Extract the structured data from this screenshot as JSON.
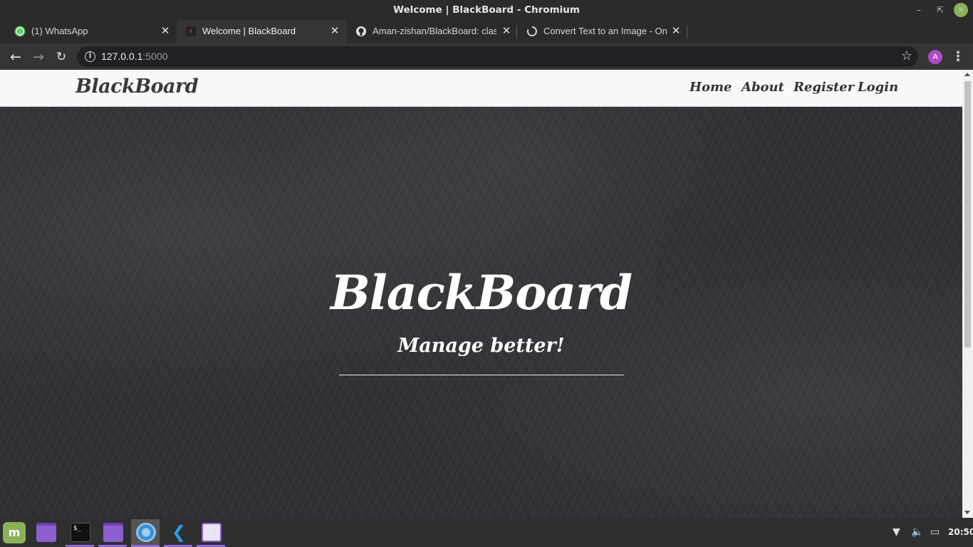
{
  "window": {
    "title": "Welcome | BlackBoard - Chromium"
  },
  "tabs": [
    {
      "label": "(1) WhatsApp",
      "favicon": "whatsapp-icon",
      "active": false
    },
    {
      "label": "Welcome | BlackBoard",
      "favicon": "page-favicon-icon",
      "active": true
    },
    {
      "label": "Aman-zishan/BlackBoard: class",
      "favicon": "github-icon",
      "active": false
    },
    {
      "label": "Convert Text to an Image - Onli",
      "favicon": "loading-spinner-icon",
      "active": false
    }
  ],
  "toolbar": {
    "url_host": "127.0.0.1",
    "url_port": ":5000",
    "avatar_letter": "A",
    "avatar_color": "#b04ac7"
  },
  "page": {
    "brand": "BlackBoard",
    "nav": {
      "home": "Home",
      "about": "About",
      "register": "Register",
      "login": "Login"
    },
    "hero": {
      "title": "BlackBoard",
      "subtitle": "Manage better!"
    }
  },
  "taskbar": {
    "apps": [
      "mint-menu",
      "files",
      "terminal",
      "files",
      "chromium",
      "vscode",
      "text-editor"
    ],
    "terminal_prompt": "$_",
    "clock": "20:50",
    "accent": "#8c6ad9"
  }
}
